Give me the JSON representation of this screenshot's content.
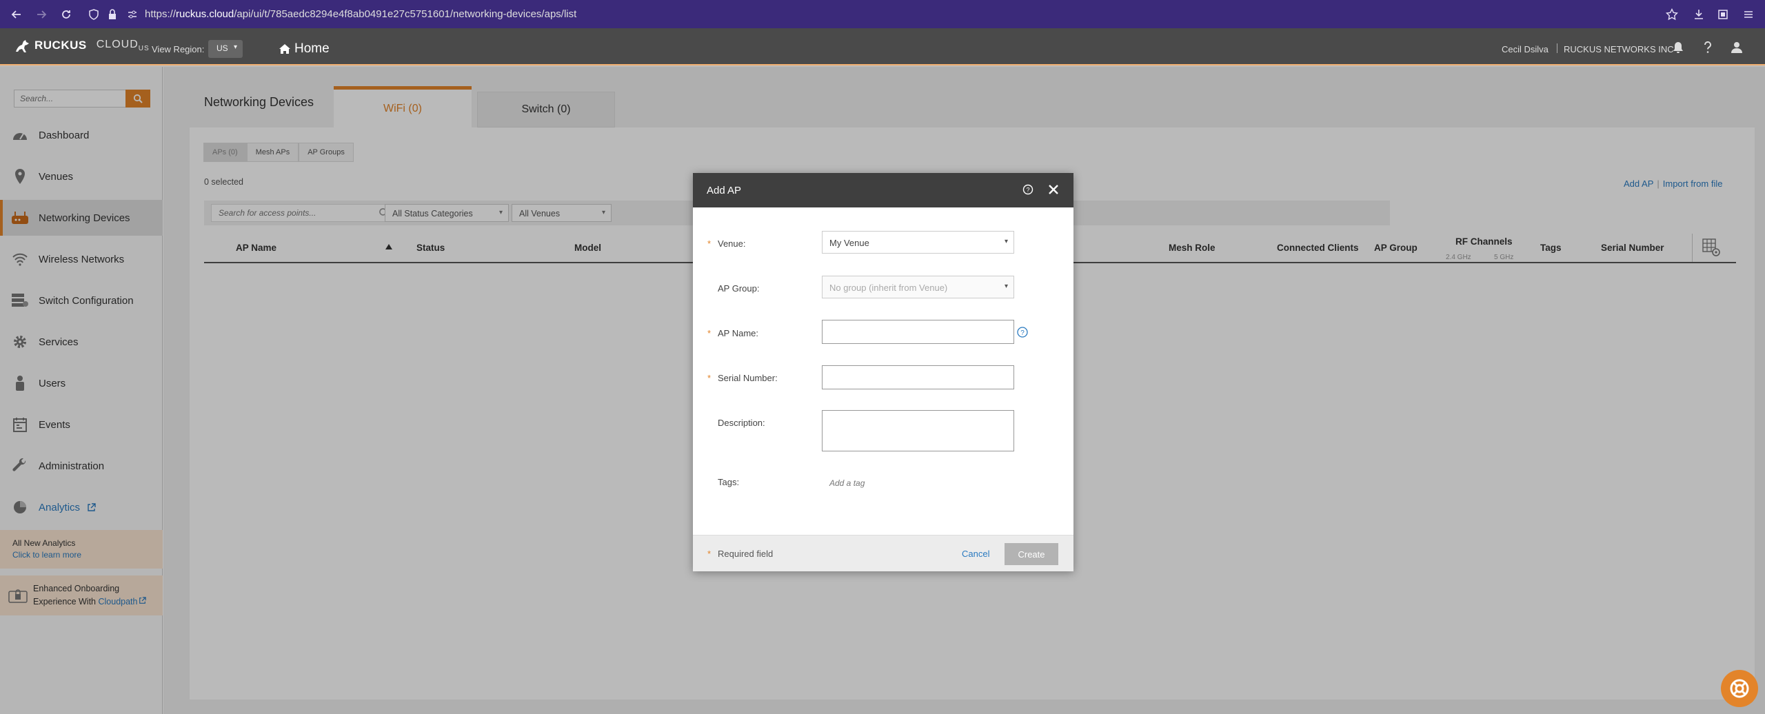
{
  "browser": {
    "url_prefix": "https://",
    "url_domain": "ruckus.cloud",
    "url_path": "/api/ui/t/785aedc8294e4f8ab0491e27c5751601/networking-devices/aps/list"
  },
  "header": {
    "brand": "RUCKUS",
    "product": "CLOUD",
    "product_sub": "US",
    "region_label": "View Region:",
    "region_value": "US",
    "home_label": "Home",
    "user_name": "Cecil Dsilva",
    "company": "RUCKUS NETWORKS INC"
  },
  "sidebar": {
    "search_placeholder": "Search...",
    "items": [
      {
        "label": "Dashboard",
        "icon": "gauge-icon"
      },
      {
        "label": "Venues",
        "icon": "map-pin-icon"
      },
      {
        "label": "Networking Devices",
        "icon": "router-icon"
      },
      {
        "label": "Wireless Networks",
        "icon": "wifi-icon"
      },
      {
        "label": "Switch Configuration",
        "icon": "switch-config-icon"
      },
      {
        "label": "Services",
        "icon": "gear-icon"
      },
      {
        "label": "Users",
        "icon": "user-icon"
      },
      {
        "label": "Events",
        "icon": "calendar-icon"
      },
      {
        "label": "Administration",
        "icon": "wrench-icon"
      },
      {
        "label": "Analytics",
        "icon": "pie-chart-icon"
      }
    ],
    "promo_analytics_title": "All New Analytics",
    "promo_analytics_link": "Click to learn more",
    "promo_onboarding_line1": "Enhanced Onboarding",
    "promo_onboarding_line2": "Experience With ",
    "promo_onboarding_link": "Cloudpath"
  },
  "main": {
    "page_title": "Networking Devices",
    "tab_wifi": "WiFi (0)",
    "tab_switch": "Switch (0)",
    "subtabs": [
      "APs (0)",
      "Mesh APs",
      "AP Groups"
    ],
    "selected_count": "0 selected",
    "add_ap_link": "Add AP",
    "import_link": "Import from file",
    "search_placeholder": "Search for access points...",
    "filter_status": "All Status Categories",
    "filter_venues": "All Venues",
    "columns": [
      "AP Name",
      "Status",
      "Model",
      "Mesh Role",
      "Connected Clients",
      "AP Group",
      "RF Channels",
      "Tags",
      "Serial Number"
    ],
    "rf_sub_24": "2.4 GHz",
    "rf_sub_5": "5 GHz"
  },
  "modal": {
    "title": "Add AP",
    "venue_label": "Venue:",
    "venue_value": "My Venue",
    "ap_group_label": "AP Group:",
    "ap_group_value": "No group (inherit from Venue)",
    "ap_name_label": "AP Name:",
    "ap_name_value": "",
    "serial_label": "Serial Number:",
    "serial_value": "",
    "description_label": "Description:",
    "description_value": "",
    "tags_label": "Tags:",
    "tags_placeholder": "Add a tag",
    "required_note": "Required field",
    "required_star": "*",
    "cancel_label": "Cancel",
    "create_label": "Create"
  },
  "colors": {
    "accent": "#e3842a",
    "link": "#2a7ac0",
    "header_bg": "#4a4a4a",
    "browser_bg": "#3b2a7a"
  }
}
